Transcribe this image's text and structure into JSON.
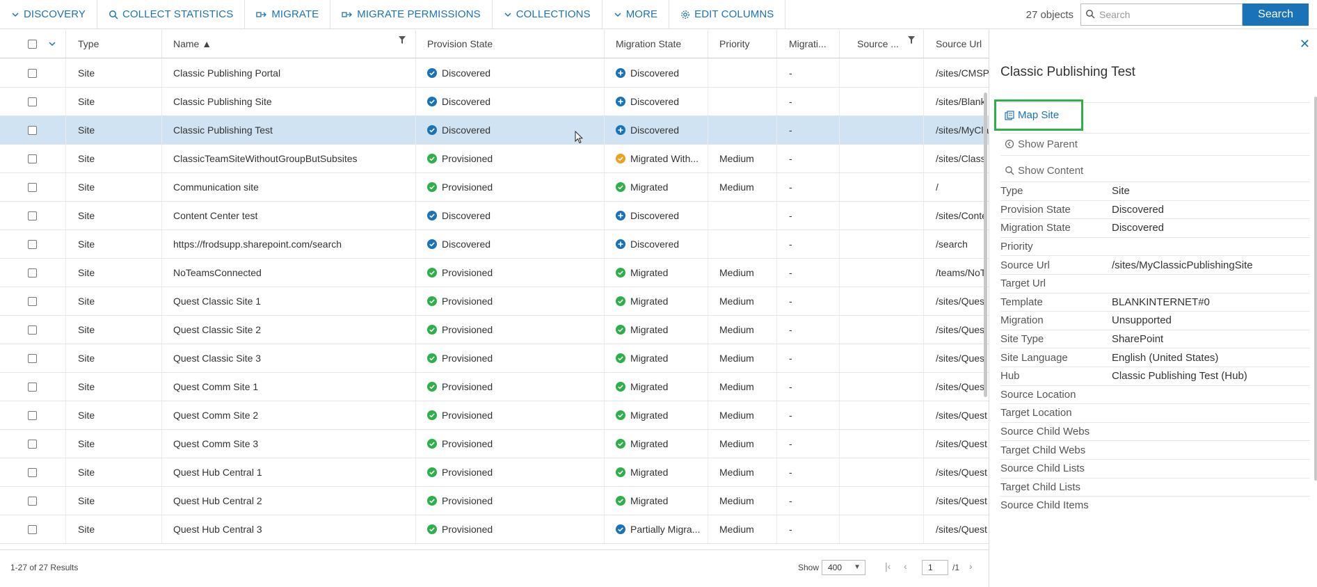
{
  "toolbar": {
    "discovery": "DISCOVERY",
    "collect_statistics": "COLLECT STATISTICS",
    "migrate": "MIGRATE",
    "migrate_permissions": "MIGRATE PERMISSIONS",
    "collections": "COLLECTIONS",
    "more": "MORE",
    "edit_columns": "EDIT COLUMNS",
    "object_count": "27 objects",
    "search_placeholder": "Search",
    "search_button": "Search"
  },
  "grid": {
    "columns": {
      "type": "Type",
      "name": "Name ▲",
      "provision_state": "Provision State",
      "migration_state": "Migration State",
      "priority": "Priority",
      "migration": "Migrati...",
      "source": "Source ...",
      "source_url": "Source Url"
    },
    "rows": [
      {
        "type": "Site",
        "name": "Classic Publishing Portal",
        "prov": "Discovered",
        "prov_kind": "discovered",
        "mig": "Discovered",
        "mig_kind": "discovered-plus",
        "priority": "",
        "migration": "-",
        "source": "",
        "url": "/sites/CMSP"
      },
      {
        "type": "Site",
        "name": "Classic Publishing Site",
        "prov": "Discovered",
        "prov_kind": "discovered",
        "mig": "Discovered",
        "mig_kind": "discovered-plus",
        "priority": "",
        "migration": "-",
        "source": "",
        "url": "/sites/Blank"
      },
      {
        "type": "Site",
        "name": "Classic Publishing Test",
        "prov": "Discovered",
        "prov_kind": "discovered",
        "mig": "Discovered",
        "mig_kind": "discovered-plus",
        "priority": "",
        "migration": "-",
        "source": "",
        "url": "/sites/MyCla"
      },
      {
        "type": "Site",
        "name": "ClassicTeamSiteWithoutGroupButSubsites",
        "prov": "Provisioned",
        "prov_kind": "ok",
        "mig": "Migrated With...",
        "mig_kind": "warn",
        "priority": "Medium",
        "migration": "-",
        "source": "",
        "url": "/sites/Classi"
      },
      {
        "type": "Site",
        "name": "Communication site",
        "prov": "Provisioned",
        "prov_kind": "ok",
        "mig": "Migrated",
        "mig_kind": "ok",
        "priority": "Medium",
        "migration": "-",
        "source": "",
        "url": "/"
      },
      {
        "type": "Site",
        "name": "Content Center test",
        "prov": "Discovered",
        "prov_kind": "discovered",
        "mig": "Discovered",
        "mig_kind": "discovered-plus",
        "priority": "",
        "migration": "-",
        "source": "",
        "url": "/sites/Conte"
      },
      {
        "type": "Site",
        "name": "https://frodsupp.sharepoint.com/search",
        "prov": "Discovered",
        "prov_kind": "discovered",
        "mig": "Discovered",
        "mig_kind": "discovered-plus",
        "priority": "",
        "migration": "-",
        "source": "",
        "url": "/search"
      },
      {
        "type": "Site",
        "name": "NoTeamsConnected",
        "prov": "Provisioned",
        "prov_kind": "ok",
        "mig": "Migrated",
        "mig_kind": "ok",
        "priority": "Medium",
        "migration": "-",
        "source": "",
        "url": "/teams/NoT"
      },
      {
        "type": "Site",
        "name": "Quest Classic Site 1",
        "prov": "Provisioned",
        "prov_kind": "ok",
        "mig": "Migrated",
        "mig_kind": "ok",
        "priority": "Medium",
        "migration": "-",
        "source": "",
        "url": "/sites/Quest"
      },
      {
        "type": "Site",
        "name": "Quest Classic Site 2",
        "prov": "Provisioned",
        "prov_kind": "ok",
        "mig": "Migrated",
        "mig_kind": "ok",
        "priority": "Medium",
        "migration": "-",
        "source": "",
        "url": "/sites/Quest"
      },
      {
        "type": "Site",
        "name": "Quest Classic Site 3",
        "prov": "Provisioned",
        "prov_kind": "ok",
        "mig": "Migrated",
        "mig_kind": "ok",
        "priority": "Medium",
        "migration": "-",
        "source": "",
        "url": "/sites/Quest"
      },
      {
        "type": "Site",
        "name": "Quest Comm Site 1",
        "prov": "Provisioned",
        "prov_kind": "ok",
        "mig": "Migrated",
        "mig_kind": "ok",
        "priority": "Medium",
        "migration": "-",
        "source": "",
        "url": "/sites/Quest"
      },
      {
        "type": "Site",
        "name": "Quest Comm Site 2",
        "prov": "Provisioned",
        "prov_kind": "ok",
        "mig": "Migrated",
        "mig_kind": "ok",
        "priority": "Medium",
        "migration": "-",
        "source": "",
        "url": "/sites/Quest"
      },
      {
        "type": "Site",
        "name": "Quest Comm Site 3",
        "prov": "Provisioned",
        "prov_kind": "ok",
        "mig": "Migrated",
        "mig_kind": "ok",
        "priority": "Medium",
        "migration": "-",
        "source": "",
        "url": "/sites/Quest"
      },
      {
        "type": "Site",
        "name": "Quest Hub Central 1",
        "prov": "Provisioned",
        "prov_kind": "ok",
        "mig": "Migrated",
        "mig_kind": "ok",
        "priority": "Medium",
        "migration": "-",
        "source": "",
        "url": "/sites/Quest"
      },
      {
        "type": "Site",
        "name": "Quest Hub Central 2",
        "prov": "Provisioned",
        "prov_kind": "ok",
        "mig": "Migrated",
        "mig_kind": "ok",
        "priority": "Medium",
        "migration": "-",
        "source": "",
        "url": "/sites/Quest"
      },
      {
        "type": "Site",
        "name": "Quest Hub Central 3",
        "prov": "Provisioned",
        "prov_kind": "ok",
        "mig": "Partially Migra...",
        "mig_kind": "partial",
        "priority": "Medium",
        "migration": "-",
        "source": "",
        "url": "/sites/Quest"
      }
    ],
    "selected_row_name": "Classic Publishing Test"
  },
  "footer": {
    "results": "1-27 of 27 Results",
    "show_label": "Show",
    "page_size": "400",
    "page": "1",
    "page_total": "/1"
  },
  "panel": {
    "title": "Classic Publishing Test",
    "map_site": "Map Site",
    "show_parent": "Show Parent",
    "show_content": "Show Content",
    "properties": [
      {
        "key": "Type",
        "value": "Site"
      },
      {
        "key": "Provision State",
        "value": "Discovered"
      },
      {
        "key": "Migration State",
        "value": "Discovered"
      },
      {
        "key": "Priority",
        "value": ""
      },
      {
        "key": "Source Url",
        "value": "/sites/MyClassicPublishingSite"
      },
      {
        "key": "Target Url",
        "value": ""
      },
      {
        "key": "Template",
        "value": "BLANKINTERNET#0"
      },
      {
        "key": "Migration",
        "value": "Unsupported"
      },
      {
        "key": "Site Type",
        "value": "SharePoint"
      },
      {
        "key": "Site Language",
        "value": "English (United States)"
      },
      {
        "key": "Hub",
        "value": "Classic Publishing Test (Hub)"
      },
      {
        "key": "Source Location",
        "value": ""
      },
      {
        "key": "Target Location",
        "value": ""
      },
      {
        "key": "Source Child Webs",
        "value": ""
      },
      {
        "key": "Target Child Webs",
        "value": ""
      },
      {
        "key": "Source Child Lists",
        "value": ""
      },
      {
        "key": "Target Child Lists",
        "value": ""
      },
      {
        "key": "Source Child Items",
        "value": ""
      }
    ]
  },
  "colors": {
    "accent": "#1a73b8",
    "ok": "#2db04b",
    "discovered": "#1a73b8",
    "warn": "#f0a020",
    "highlight_border": "#2db04b",
    "selected_row": "#cfe3f3"
  },
  "icons": {
    "discovery": "chevron-down-icon",
    "collect_statistics": "search-icon",
    "migrate": "migrate-icon",
    "migrate_permissions": "migrate-icon",
    "collections": "chevron-down-icon",
    "more": "chevron-down-icon",
    "edit_columns": "gear-icon"
  }
}
